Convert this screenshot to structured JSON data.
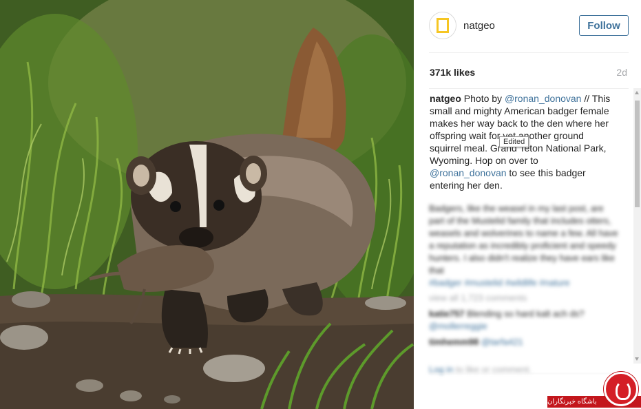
{
  "post": {
    "image_alt": "American badger carrying a ground squirrel",
    "username": "natgeo",
    "avatar_text": "NATIONAL GEOGRAPHIC",
    "follow_label": "Follow",
    "likes": "371k likes",
    "age": "2d"
  },
  "caption": {
    "author": "natgeo",
    "part1": "Photo by ",
    "mention1": "@ronan_donovan",
    "part2": " // This small and mighty American badger female makes her way back to the den where her offspring wait for yet another ground squirrel meal. Grand Teton National Park, Wyoming. Hop on over to ",
    "mention2": "@ronan_donovan",
    "part3": " to see this badger entering her den."
  },
  "tooltip": "Edited",
  "blurred": {
    "paragraph": "Badgers, like the weasel in my last post, are part of the Mustelid family that includes otters, weasels and wolverines to name a few. All have a reputation as incredibly proficient and speedy hunters. I also didn't realize they have ears like that",
    "hashtags": "#badger #mustelid #wildlife #nature",
    "view_all": "view all 1,723 comments",
    "comments": [
      {
        "user": "katie757",
        "text": " Blending so hard kalt ach ds? ",
        "mention": "@mollerreggie"
      },
      {
        "user": "timhemm98",
        "text": " ",
        "mention": "@tarfa421"
      }
    ],
    "login_link": "Log in",
    "login_rest": " to like or comment."
  },
  "watermark": {
    "text": "باشگاه خبرنگاران"
  },
  "colors": {
    "link": "#3f729b",
    "muted": "#a5a7aa",
    "text": "#262626",
    "watermark_red": "#c3161c"
  }
}
